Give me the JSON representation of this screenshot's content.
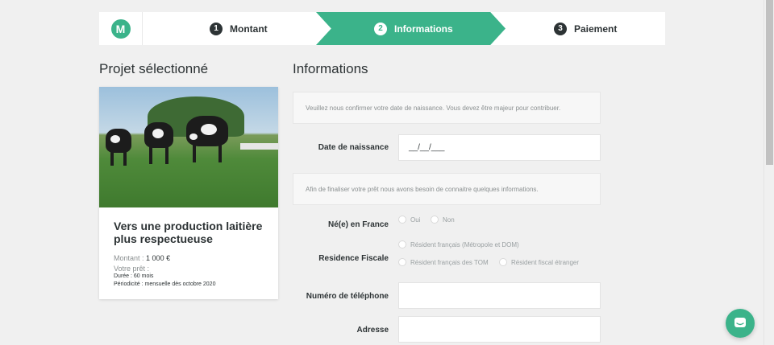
{
  "stepper": {
    "logo": "M",
    "steps": [
      {
        "num": "1",
        "label": "Montant"
      },
      {
        "num": "2",
        "label": "Informations"
      },
      {
        "num": "3",
        "label": "Paiement"
      }
    ],
    "active_color": "#3bb38a"
  },
  "project": {
    "heading": "Projet sélectionné",
    "title": "Vers une production laitière plus respectueuse",
    "amount_label": "Montant :",
    "amount_value": "1 000 €",
    "return_label": "Votre prêt :",
    "duration": "Durée : 60 mois",
    "periodicity": "Périodicité : mensuelle dès octobre 2020"
  },
  "form": {
    "heading": "Informations",
    "notice_birth": "Veuillez nous confirmer votre date de naissance. Vous devez être majeur pour contribuer.",
    "birthdate_label": "Date de naissance",
    "birthdate_value": "__/__/___",
    "notice_info": "Afin de finaliser votre prêt nous avons besoin de connaitre quelques informations.",
    "born_france_label": "Né(e) en France",
    "born_france_options": [
      "Oui",
      "Non"
    ],
    "tax_label": "Residence Fiscale",
    "tax_options": [
      "Résident français (Métropole et DOM)",
      "Résident français des TOM",
      "Résident fiscal étranger"
    ],
    "phone_label": "Numéro de téléphone",
    "address_label": "Adresse"
  },
  "icons": {
    "chat": "chat-icon"
  }
}
